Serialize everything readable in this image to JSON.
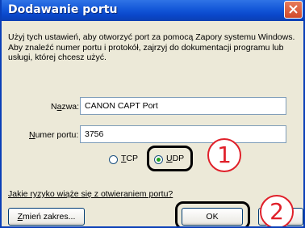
{
  "window": {
    "title": "Dodawanie portu",
    "close_icon": "close-icon"
  },
  "description": "Użyj tych ustawień, aby otworzyć port za pomocą Zapory systemu Windows. Aby znaleźć numer portu i protokół, zajrzyj do dokumentacji programu lub usługi, której chcesz użyć.",
  "name_field": {
    "label_prefix": "N",
    "label_mnemonic": "a",
    "label_suffix": "zwa:",
    "value": "CANON CAPT Port"
  },
  "port_field": {
    "label_mnemonic": "N",
    "label_suffix": "umer portu:",
    "value": "3756"
  },
  "protocol": {
    "tcp_mnemonic": "T",
    "tcp_suffix": "CP",
    "udp_mnemonic": "U",
    "udp_suffix": "DP",
    "selected": "UDP"
  },
  "risk_link": "Jakie ryzyko wiąże się z otwieraniem portu?",
  "buttons": {
    "change_scope_mnemonic": "Z",
    "change_scope_suffix": "mień zakres...",
    "ok": "OK"
  },
  "callouts": {
    "one": "1",
    "two": "2"
  },
  "colors": {
    "title_bar": "#1357d8",
    "callout": "#e0202a",
    "radio_selected": "#21a121"
  }
}
